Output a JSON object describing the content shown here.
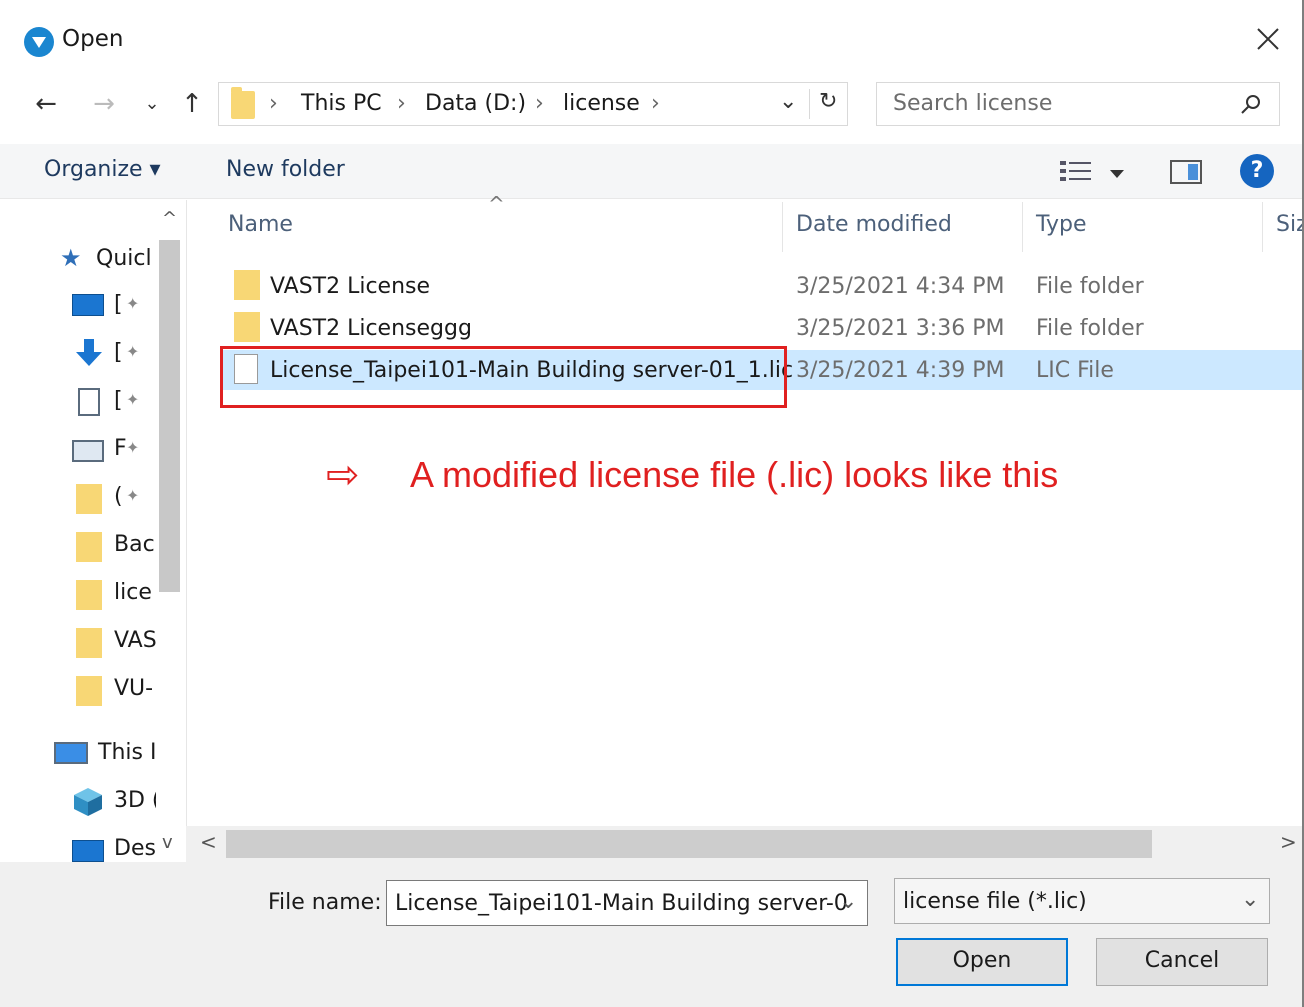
{
  "window": {
    "title": "Open",
    "close_glyph": "✕"
  },
  "nav": {
    "back": "←",
    "forward": "→",
    "recent": "⌄",
    "up": "↑"
  },
  "address": {
    "crumbs": [
      "This PC",
      "Data (D:)",
      "license"
    ],
    "separator": "›",
    "dropdown": "⌄",
    "refresh": "↻"
  },
  "search": {
    "placeholder": "Search license",
    "icon": "⚲"
  },
  "toolbar": {
    "organize": "Organize ▾",
    "new_folder": "New folder",
    "help": "?"
  },
  "nav_pane": {
    "items": [
      {
        "label": "Quicl",
        "icon": "star-icon"
      },
      {
        "label": "[",
        "icon": "desktop-icon",
        "pin": "✦"
      },
      {
        "label": "[",
        "icon": "download-icon",
        "pin": "✦"
      },
      {
        "label": "[",
        "icon": "document-icon",
        "pin": "✦"
      },
      {
        "label": "F",
        "icon": "pictures-icon",
        "pin": "✦"
      },
      {
        "label": "(",
        "icon": "folder-icon",
        "pin": "✦"
      },
      {
        "label": "Bac",
        "icon": "folder-icon"
      },
      {
        "label": "lice",
        "icon": "folder-icon"
      },
      {
        "label": "VAS",
        "icon": "folder-icon"
      },
      {
        "label": "VU-",
        "icon": "folder-icon"
      },
      {
        "label": "This I",
        "icon": "pc-icon"
      },
      {
        "label": "3D (",
        "icon": "3d-objects-icon"
      },
      {
        "label": "Des",
        "icon": "desktop-icon"
      }
    ],
    "scroll_up": "^",
    "scroll_down": "v"
  },
  "file_list": {
    "columns": [
      "Name",
      "Date modified",
      "Type",
      "Siz"
    ],
    "sort_glyph": "^",
    "rows": [
      {
        "name": "VAST2 License",
        "date": "3/25/2021 4:34 PM",
        "type": "File folder",
        "kind": "folder"
      },
      {
        "name": "VAST2 Licenseggg",
        "date": "3/25/2021 3:36 PM",
        "type": "File folder",
        "kind": "folder"
      },
      {
        "name": "License_Taipei101-Main Building server-01_1.lic",
        "date": "3/25/2021 4:39 PM",
        "type": "LIC File",
        "kind": "file"
      }
    ],
    "selected_row": 2
  },
  "annotation": {
    "arrow": "⇨",
    "text": "A modified license file (.lic) looks like this"
  },
  "hscroll": {
    "left": "<",
    "right": ">"
  },
  "footer": {
    "file_name_label": "File name:",
    "file_name_value": "License_Taipei101-Main Building server-0",
    "filter_value": "license file (*.lic)",
    "open_label": "Open",
    "cancel_label": "Cancel",
    "dropdown": "⌄"
  }
}
